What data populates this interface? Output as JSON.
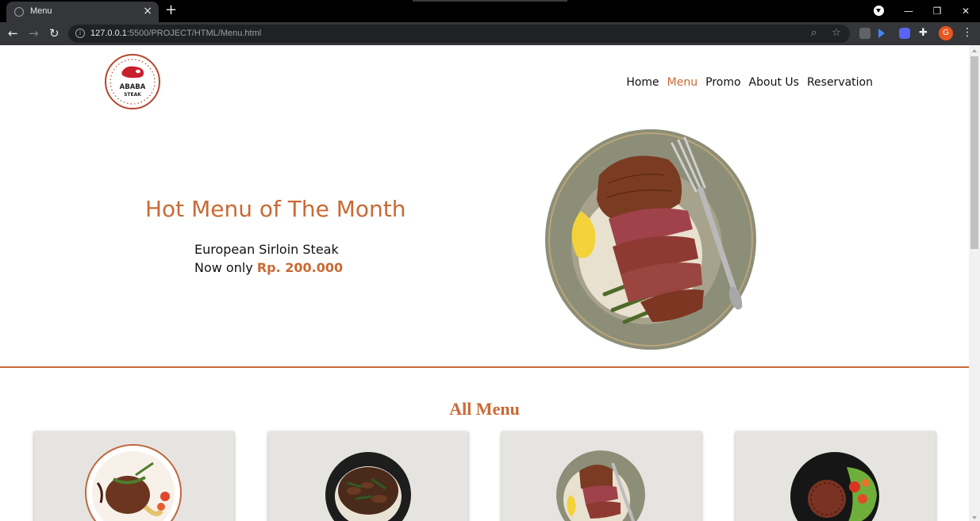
{
  "browser": {
    "tab_title": "Menu",
    "tab_close": "×",
    "new_tab": "+",
    "url_host": "127.0.0.1",
    "url_path": ":5500/PROJECT/HTML/Menu.html",
    "avatar_letter": "G",
    "window_buttons": [
      "—",
      "❐",
      "✕"
    ]
  },
  "site": {
    "logo_text_top": "ABABA",
    "logo_text_bottom": "STEAK",
    "nav": [
      {
        "label": "Home",
        "active": false
      },
      {
        "label": "Menu",
        "active": true
      },
      {
        "label": "Promo",
        "active": false
      },
      {
        "label": "About Us",
        "active": false
      },
      {
        "label": "Reservation",
        "active": false
      }
    ]
  },
  "hero": {
    "title": "Hot Menu of The Month",
    "dish": "European Sirloin Steak",
    "price_prefix": "Now only ",
    "price": "Rp. 200.000"
  },
  "menu": {
    "section_title": "All Menu",
    "cards": [
      {
        "image": "steak-plate-with-vegetables"
      },
      {
        "image": "beef-rice-bowl"
      },
      {
        "image": "sliced-steak-plate"
      },
      {
        "image": "burger-patty-with-salad"
      }
    ]
  },
  "colors": {
    "accent": "#c96a34",
    "card_bg": "#e6e4e1",
    "browser_dark": "#35363a"
  }
}
